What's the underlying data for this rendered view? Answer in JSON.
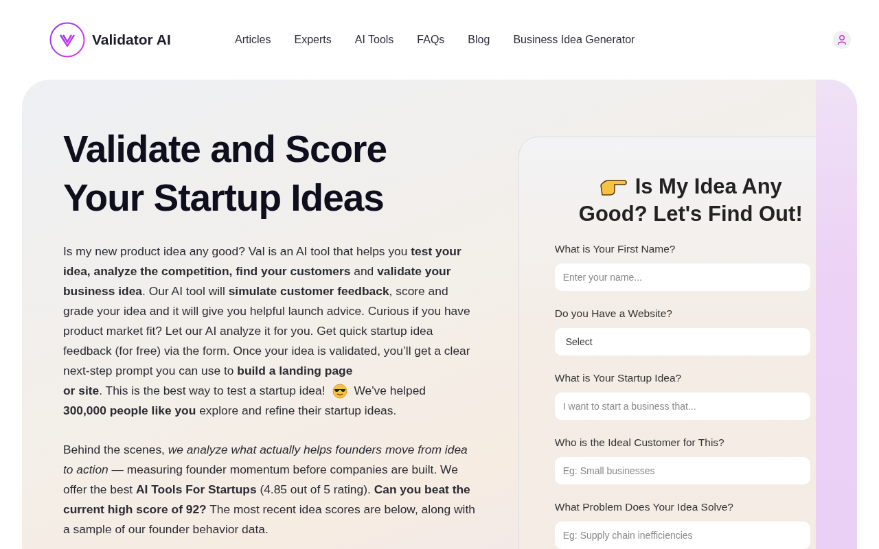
{
  "header": {
    "logo_text": "Validator AI",
    "nav": [
      {
        "label": "Articles"
      },
      {
        "label": "Experts"
      },
      {
        "label": "AI Tools"
      },
      {
        "label": "FAQs"
      },
      {
        "label": "Blog"
      },
      {
        "label": "Business Idea Generator"
      }
    ]
  },
  "hero": {
    "title_lines": [
      "Validate and Score",
      "Your Startup Ideas"
    ],
    "intro": [
      "Is my new product idea any good?   Val is an AI tool that helps you **test your idea, analyze the competition, find your customers** and **validate your business idea**.  Our AI tool will **simulate customer feedback**, score and grade your idea and it will give you helpful launch advice.  Curious if you have product market fit?  Let our AI analyze it for you.  Get quick startup idea feedback (for free) via the form.  Once your idea is validated, you’ll get a clear next-step prompt you can use to **build a landing page**",
      "**or site**.  This is the best way to test a startup idea!",
      "We've helped",
      "**300,000 people like you** explore and refine their startup ideas."
    ],
    "second_paragraph": "Behind the scenes, *we analyze what actually helps founders move from idea to action* — measuring founder momentum before companies are built. We offer the best **AI Tools For Startups** (4.85 out of 5 rating).  **Can you beat the current high score of 92?**  The most recent idea scores are below, along with a sample of our founder behavior data."
  },
  "form": {
    "title_lines": [
      "Is My Idea Any",
      "Good?  Let's Find Out!"
    ],
    "fields": [
      {
        "kind": "input",
        "label": "What is Your First Name?",
        "placeholder": "Enter your name..."
      },
      {
        "kind": "select",
        "label": "Do you Have a Website?",
        "value": "Select"
      },
      {
        "kind": "input",
        "label": "What is Your Startup Idea?",
        "placeholder": "I want to start a business that..."
      },
      {
        "kind": "input",
        "label": "Who is the Ideal Customer for This?",
        "placeholder": "Eg: Small businesses"
      },
      {
        "kind": "input",
        "label": "What Problem Does Your Idea Solve?",
        "placeholder": "Eg: Supply chain inefficiencies"
      }
    ]
  }
}
